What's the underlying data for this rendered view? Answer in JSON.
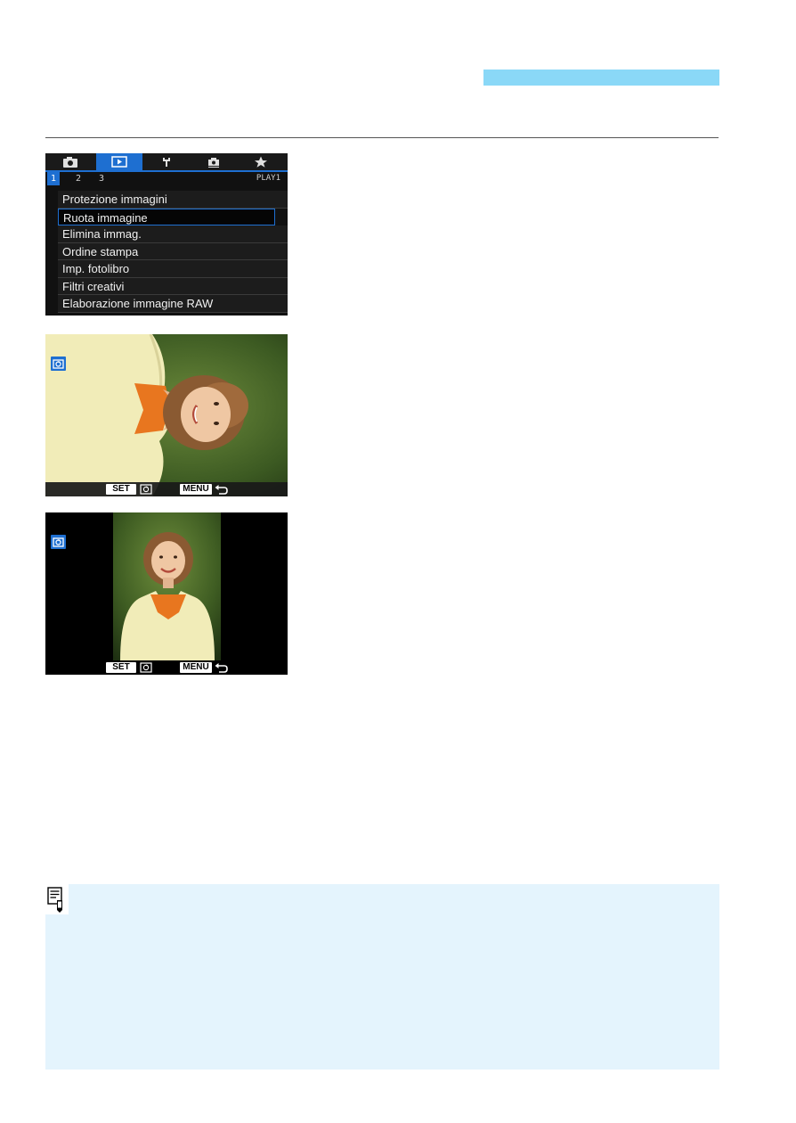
{
  "menu": {
    "tab_icons": [
      "camera-icon",
      "playback-icon",
      "wrench-icon",
      "custom-function-icon",
      "star-icon"
    ],
    "pages": [
      "1",
      "2",
      "3"
    ],
    "page_label": "PLAY1",
    "items": [
      "Protezione immagini",
      "Ruota immagine",
      "Elimina immag.",
      "Ordine stampa",
      "Imp. fotolibro",
      "Filtri creativi",
      "Elaborazione immagine RAW"
    ],
    "selected_index": 1
  },
  "screen_controls": {
    "set_key": "SET",
    "menu_key": "MENU",
    "icons": [
      "rotate-icon",
      "return-icon"
    ]
  },
  "colors": {
    "header_band": "#8ad8f7",
    "accent_blue": "#1e6fd1",
    "note_background": "#e4f4fd"
  }
}
